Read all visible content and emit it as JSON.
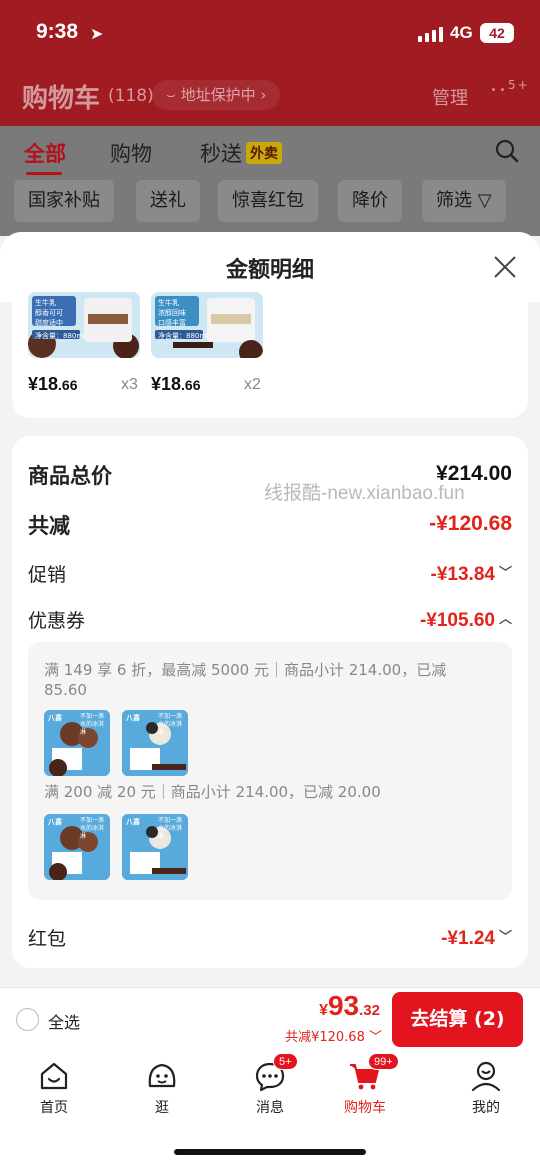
{
  "status_bar": {
    "time": "9:38",
    "network": "4G",
    "battery": "42"
  },
  "cart_header": {
    "title": "购物车",
    "count": "(118)",
    "address_pill": "地址保护中",
    "manage": "管理",
    "more_badge": "5+"
  },
  "tabs": [
    {
      "label": "全部",
      "active": true
    },
    {
      "label": "购物",
      "active": false
    },
    {
      "label": "秒送",
      "active": false,
      "tag": "外卖"
    }
  ],
  "filter_chips": [
    "国家补贴",
    "送礼",
    "惊喜红包",
    "降价",
    "筛选"
  ],
  "sheet": {
    "title": "金额明细",
    "products": [
      {
        "price_int": "¥18",
        "price_dec": ".66",
        "qty": "x3",
        "tags": [
          "生牛乳",
          "醇香可可",
          "甜度适中"
        ],
        "net": "净含量：880ml"
      },
      {
        "price_int": "¥18",
        "price_dec": ".66",
        "qty": "x2",
        "tags": [
          "生牛乳",
          "浓醇回味",
          "口感丰富"
        ],
        "net": "净含量：880ml"
      }
    ],
    "brand": "八喜",
    "watermark": "线报酷-new.xianbao.fun",
    "rows": {
      "subtotal_label": "商品总价",
      "subtotal_value": "¥214.00",
      "discount_label": "共减",
      "discount_value": "-¥120.68",
      "promo_label": "促销",
      "promo_value": "-¥13.84",
      "coupon_label": "优惠券",
      "coupon_value": "-¥105.60",
      "redpacket_label": "红包",
      "redpacket_value": "-¥1.24"
    },
    "coupons": [
      {
        "text": "满 149 享 6 折，最高减 5000 元｜商品小计 214.00，已减 85.60"
      },
      {
        "text": "满 200 减 20 元｜商品小计 214.00，已减 20.00"
      }
    ],
    "mini_thumb_text": "不加一滴水的冰淇淋"
  },
  "checkout": {
    "select_all": "全选",
    "currency": "¥",
    "total_int": "93",
    "total_dec": ".32",
    "saved": "共减¥120.68",
    "button": "去结算 (2)"
  },
  "tabbar": [
    {
      "label": "首页",
      "icon": "home-icon"
    },
    {
      "label": "逛",
      "icon": "browse-icon"
    },
    {
      "label": "消息",
      "icon": "message-icon",
      "badge": "5+"
    },
    {
      "label": "购物车",
      "icon": "cart-icon",
      "badge": "99+",
      "active": true
    },
    {
      "label": "我的",
      "icon": "profile-icon"
    }
  ],
  "colors": {
    "accent": "#e3141d",
    "price_red": "#e2231a",
    "header_dark_red": "#a01b22"
  }
}
